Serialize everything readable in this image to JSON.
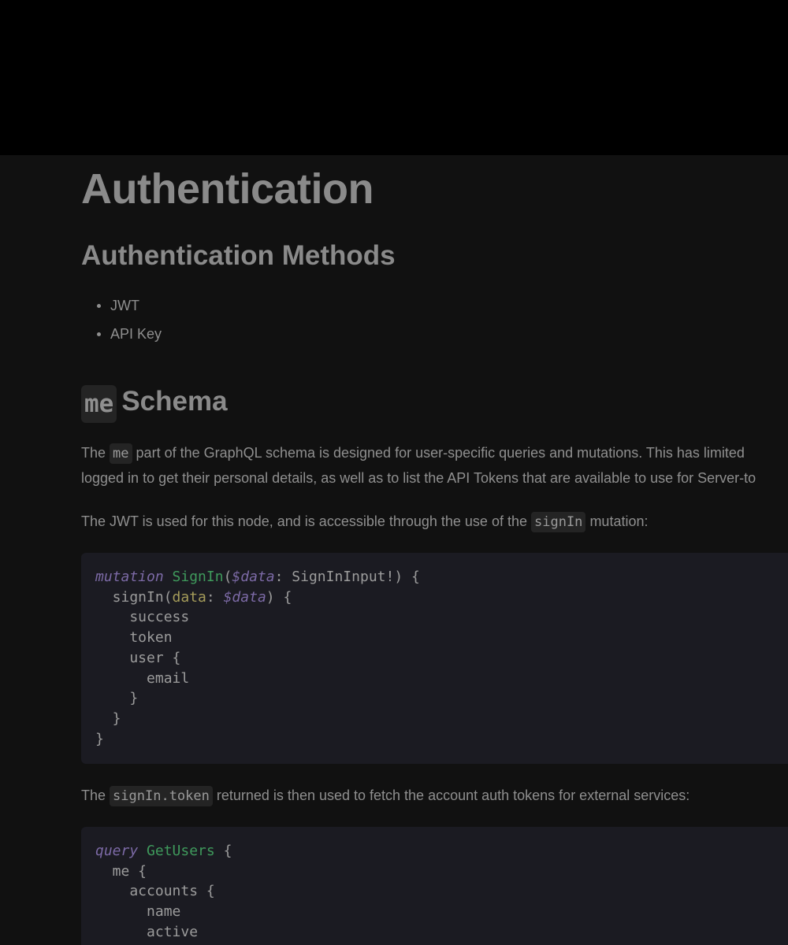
{
  "page": {
    "title": "Authentication",
    "methods_heading": "Authentication Methods",
    "methods": [
      "JWT",
      "API Key"
    ],
    "schema_heading_code": "me",
    "schema_heading_text": "Schema"
  },
  "para1": {
    "prefix": "The",
    "code": "me",
    "line1_rest": "part of the GraphQL schema is designed for user-specific queries and mutations. This has limited",
    "line2": "logged in to get their personal details, as well as to list the API Tokens that are available to use for Server-to"
  },
  "para2": {
    "text": "The JWT is used for this node, and is accessible through the use of the",
    "code": "signIn",
    "suffix": "mutation:"
  },
  "code1": {
    "l1_kw": "mutation",
    "l1_fn": "SignIn",
    "l1_open": "(",
    "l1_var": "$data",
    "l1_rest": ": SignInInput!) {",
    "l2_a": "  signIn(",
    "l2_arg": "data",
    "l2_b": ": ",
    "l2_var": "$data",
    "l2_c": ") {",
    "lines": [
      "    success",
      "    token",
      "    user {",
      "      email",
      "    }",
      "  }",
      "}"
    ]
  },
  "para3": {
    "prefix": "The",
    "code": "signIn.token",
    "suffix": "returned is then used to fetch the account auth tokens for external services:"
  },
  "code2": {
    "l1_kw": "query",
    "l1_fn": "GetUsers",
    "l1_rest": " {",
    "lines": [
      "  me {",
      "    accounts {",
      "      name",
      "      active"
    ]
  }
}
